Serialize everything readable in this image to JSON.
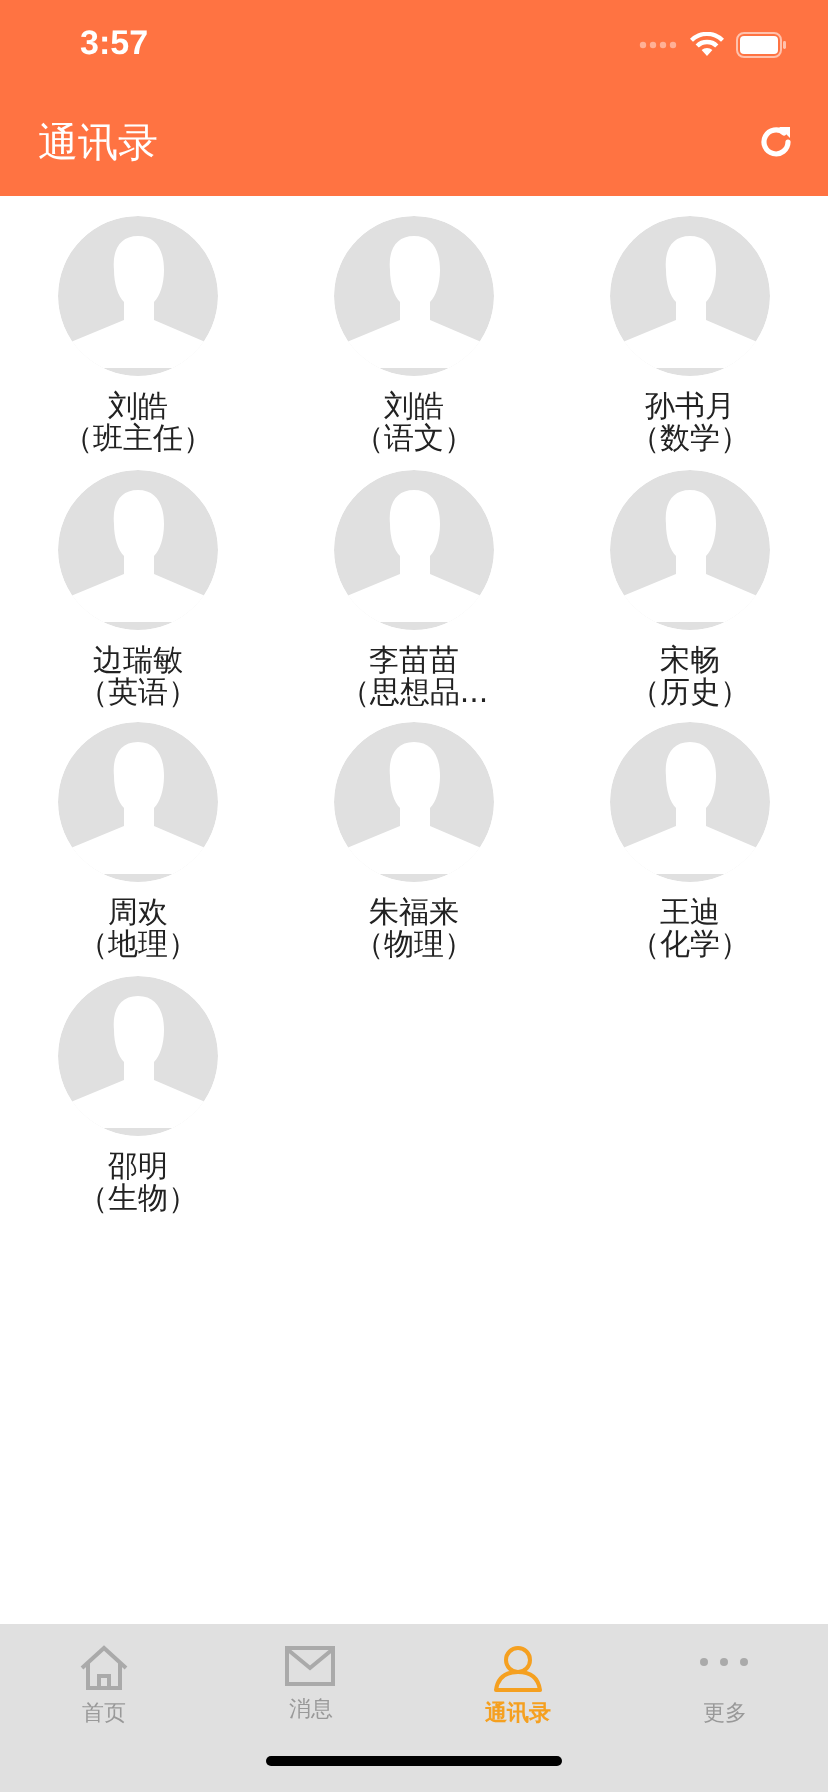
{
  "status_bar": {
    "time": "3:57"
  },
  "header": {
    "title": "通讯录"
  },
  "contacts": [
    {
      "name": "刘皓",
      "role": "（班主任）"
    },
    {
      "name": "刘皓",
      "role": "（语文）"
    },
    {
      "name": "孙书月",
      "role": "（数学）"
    },
    {
      "name": "边瑞敏",
      "role": "（英语）"
    },
    {
      "name": "李苗苗",
      "role": "（思想品..."
    },
    {
      "name": "宋畅",
      "role": "（历史）"
    },
    {
      "name": "周欢",
      "role": "（地理）"
    },
    {
      "name": "朱福来",
      "role": "（物理）"
    },
    {
      "name": "王迪",
      "role": "（化学）"
    },
    {
      "name": "邵明",
      "role": "（生物）"
    }
  ],
  "tab_bar": [
    {
      "kind": "home",
      "label": "首页",
      "selected": false
    },
    {
      "kind": "mail",
      "label": "消息",
      "selected": false
    },
    {
      "kind": "contacts",
      "label": "通讯录",
      "selected": true
    },
    {
      "kind": "more",
      "label": "更多",
      "selected": false
    }
  ]
}
